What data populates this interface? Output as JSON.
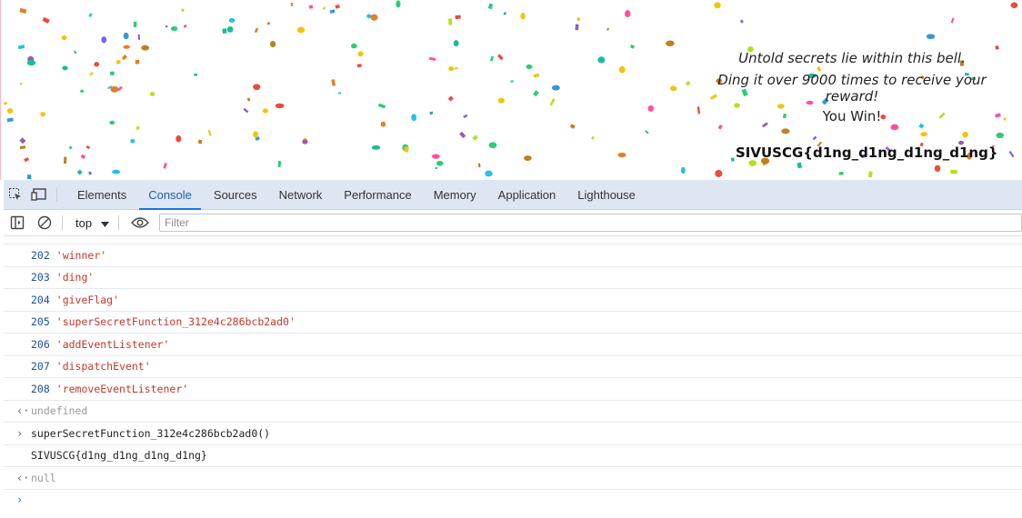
{
  "page": {
    "line1": "Untold secrets lie within this bell.",
    "line2": "Ding it over 9000 times to receive your reward!",
    "you_win": "You Win!",
    "flag": "SIVUSCG{d1ng_d1ng_d1ng_d1ng}"
  },
  "devtools": {
    "tabs": [
      "Elements",
      "Console",
      "Sources",
      "Network",
      "Performance",
      "Memory",
      "Application",
      "Lighthouse"
    ],
    "active_tab": "Console",
    "context": "top",
    "filter_placeholder": "Filter"
  },
  "console": {
    "entries": [
      {
        "index": "202",
        "value": "'winner'"
      },
      {
        "index": "203",
        "value": "'ding'"
      },
      {
        "index": "204",
        "value": "'giveFlag'"
      },
      {
        "index": "205",
        "value": "'superSecretFunction_312e4c286bcb2ad0'"
      },
      {
        "index": "206",
        "value": "'addEventListener'"
      },
      {
        "index": "207",
        "value": "'dispatchEvent'"
      },
      {
        "index": "208",
        "value": "'removeEventListener'"
      }
    ],
    "result1": "undefined",
    "command": "superSecretFunction_312e4c286bcb2ad0()",
    "output": "SIVUSCG{d1ng_d1ng_d1ng_d1ng}",
    "result2": "null",
    "prompt_symbol": "›"
  },
  "colors": {
    "accent": "#1a73e8",
    "tabbar_bg": "#dfe6f3",
    "string_red": "#c0392b",
    "index_blue": "#1c4fa0"
  },
  "icons": [
    "inspect-element-icon",
    "device-toolbar-icon",
    "sidebar-toggle-icon",
    "clear-console-icon",
    "dropdown-arrow-icon",
    "live-expression-eye-icon"
  ]
}
